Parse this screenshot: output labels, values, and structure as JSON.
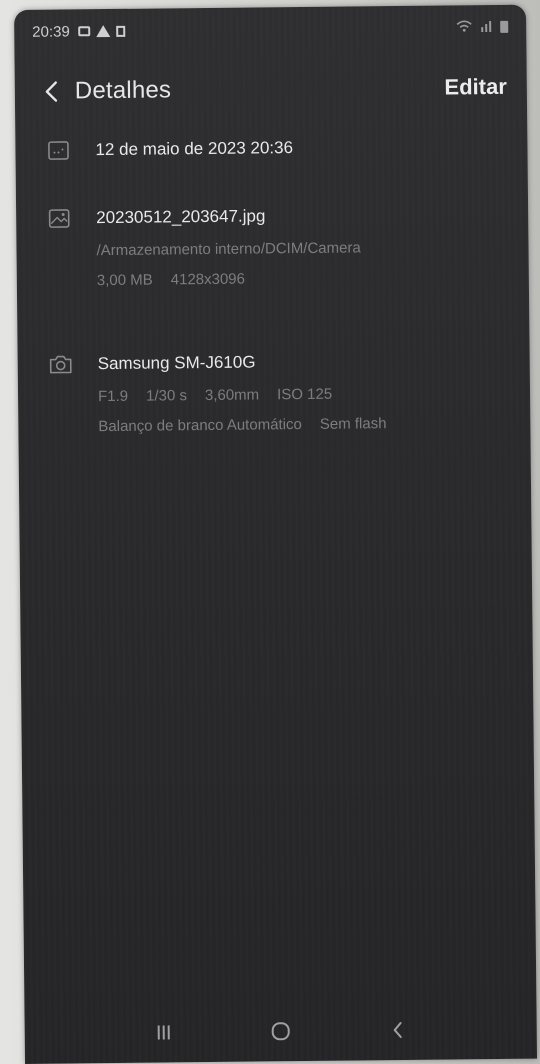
{
  "status_bar": {
    "time": "20:39"
  },
  "header": {
    "title": "Detalhes",
    "edit_label": "Editar"
  },
  "details": {
    "date": "12 de maio de 2023 20:36",
    "file": {
      "name": "20230512_203647.jpg",
      "path": "/Armazenamento interno/DCIM/Camera",
      "size": "3,00 MB",
      "resolution": "4128x3096"
    },
    "camera": {
      "model": "Samsung SM-J610G",
      "aperture": "F1.9",
      "exposure": "1/30 s",
      "focal_length": "3,60mm",
      "iso": "ISO 125",
      "white_balance": "Balanço de branco Automático",
      "flash": "Sem flash"
    }
  },
  "icons": {
    "back": "chevron-left-icon",
    "date": "calendar-icon",
    "file": "image-icon",
    "camera": "camera-icon",
    "nav_recents": "recents-icon",
    "nav_home": "home-icon",
    "nav_back": "back-icon"
  },
  "colors": {
    "background": "#2a2a2c",
    "primary_text": "#e9e9e9",
    "secondary_text": "#7d7d7f"
  }
}
